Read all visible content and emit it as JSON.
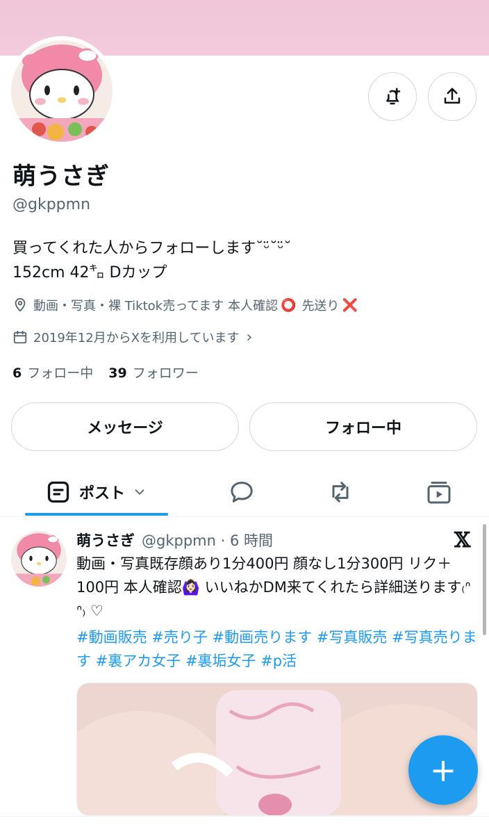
{
  "profile": {
    "name": "萌うさぎ",
    "handle": "@gkppmn",
    "bio_line1": "買ってくれた人からフォローします˘ᵕ̈˘ᵕ̈˘",
    "bio_line2": "152cm 42㌔ Dカップ",
    "location": "動画・写真・裸 Tiktok売ってます 本人確認",
    "location_ok_mark": "⭕",
    "location_suffix": "先送り",
    "location_ng_mark": "❌",
    "joined": "2019年12月からXを利用しています",
    "joined_chevron": "›",
    "following_count": "6",
    "following_label": "フォロー中",
    "followers_count": "39",
    "followers_label": "フォロワー"
  },
  "actions": {
    "message_label": "メッセージ",
    "following_label": "フォロー中"
  },
  "tabs": {
    "posts_label": "ポスト"
  },
  "tweet": {
    "name": "萌うさぎ",
    "handle_time": "@gkppmn · 6 時間",
    "x_logo": "𝕏",
    "body": "動画・写真既存顔あり1分400円 顔なし1分300円 リク＋100円 本人確認🙆🏻‍♀️ いいねかDM来てくれたら詳細送ります₍ᐢ ᐢ₎ ♡",
    "hashtags": "#動画販売 #売り子 #動画売ります #写真販売 #写真売ります #裏アカ女子 #裏垢女子 #p活"
  },
  "fab_label": "+",
  "colors": {
    "accent": "#1d9bf0",
    "banner": "#f0c6d8",
    "secondary_text": "#536471",
    "border": "#cfd9de"
  },
  "icons": {
    "notify": "bell-plus-icon",
    "share": "share-icon",
    "location": "location-pin-icon",
    "calendar": "calendar-icon",
    "posts": "post-icon",
    "replies": "reply-bubble-icon",
    "reposts": "repost-icon",
    "media": "media-icon"
  }
}
